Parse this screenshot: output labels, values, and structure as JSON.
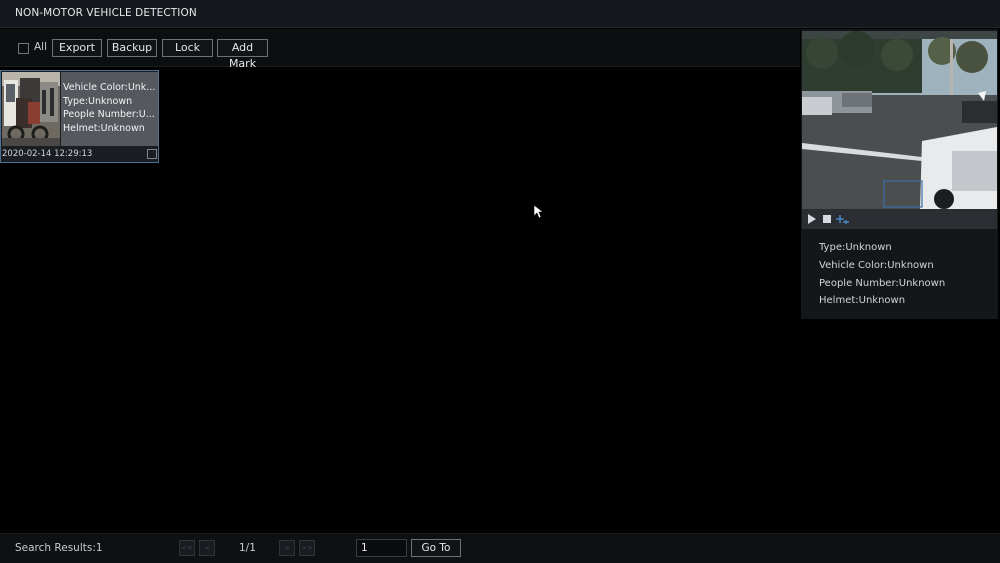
{
  "app": {
    "title": "NON-MOTOR VEHICLE DETECTION"
  },
  "toolbar": {
    "select_all_label": "All",
    "buttons": [
      "Export",
      "Backup",
      "Lock",
      "Add Mark"
    ]
  },
  "results": [
    {
      "vehicle_color": "Vehicle Color:Unk...",
      "type": "Type:Unknown",
      "people_number": "People Number:U...",
      "helmet": "Helmet:Unknown",
      "timestamp": "2020-02-14 12:29:13"
    }
  ],
  "detail_panel": {
    "type": "Type:Unknown",
    "vehicle_color": "Vehicle Color:Unknown",
    "people_number": "People Number:Unknown",
    "helmet": "Helmet:Unknown"
  },
  "pagination": {
    "search_results": "Search Results:1",
    "page": "1/1",
    "goto_value": "1",
    "goto_label": "Go To",
    "first_icon": "<<",
    "prev_icon": "<",
    "next_icon": ">",
    "last_icon": ">>"
  },
  "icons": [
    "checkbox-icon",
    "play-icon",
    "stop-icon",
    "zoom-icon",
    "cursor-icon"
  ],
  "colors": {
    "accent": "#4d6f8f",
    "background": "#000000",
    "panel": "#14171a"
  }
}
